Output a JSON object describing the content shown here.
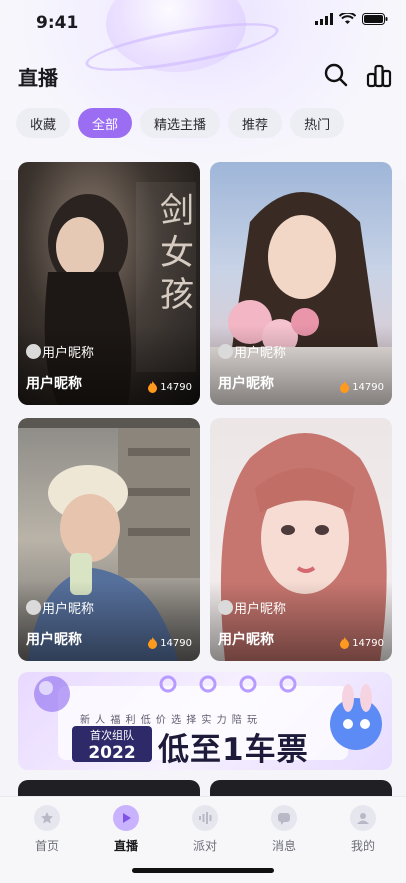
{
  "status_bar": {
    "time": "9:41"
  },
  "header": {
    "title": "直播"
  },
  "tabs": [
    {
      "label": "收藏"
    },
    {
      "label": "全部",
      "active": true
    },
    {
      "label": "精选主播"
    },
    {
      "label": "推荐"
    },
    {
      "label": "热门"
    }
  ],
  "cards": [
    {
      "nickname_small": "用户昵称",
      "nickname": "用户昵称",
      "count": "14790",
      "art_text": "剑 女 孩"
    },
    {
      "nickname_small": "用户昵称",
      "nickname": "用户昵称",
      "count": "14790"
    },
    {
      "nickname_small": "用户昵称",
      "nickname": "用户昵称",
      "count": "14790"
    },
    {
      "nickname_small": "用户昵称",
      "nickname": "用户昵称",
      "count": "14790"
    }
  ],
  "banner": {
    "small_text": "新 人 福 利 低 价 选 择 实 力 陪 玩",
    "badge_top": "首次组队",
    "badge_year": "2022",
    "headline": "低至1车票"
  },
  "bottom_nav": [
    {
      "label": "首页",
      "icon": "home-icon"
    },
    {
      "label": "直播",
      "icon": "live-icon",
      "active": true
    },
    {
      "label": "派对",
      "icon": "party-icon"
    },
    {
      "label": "消息",
      "icon": "message-icon"
    },
    {
      "label": "我的",
      "icon": "profile-icon"
    }
  ],
  "colors": {
    "accent": "#9a6df2",
    "background": "#f5f5f9"
  }
}
